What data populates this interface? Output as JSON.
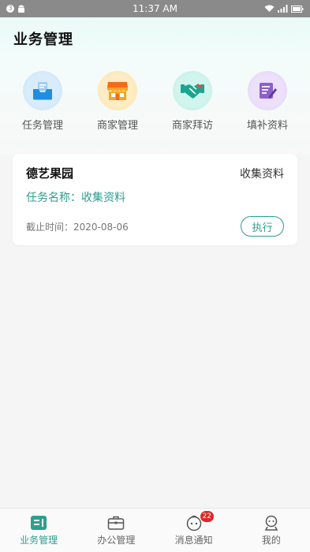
{
  "status_bar": {
    "time": "11:37 AM",
    "notification_count": "3"
  },
  "header": {
    "title": "业务管理"
  },
  "quick_nav": [
    {
      "label": "任务管理",
      "icon": "inbox-icon",
      "color": "#1e8fe0"
    },
    {
      "label": "商家管理",
      "icon": "store-icon",
      "color": "#f29a1a"
    },
    {
      "label": "商家拜访",
      "icon": "handshake-icon",
      "color": "#1aa58f"
    },
    {
      "label": "填补资料",
      "icon": "edit-document-icon",
      "color": "#8e5fd0"
    }
  ],
  "task_card": {
    "shop_name": "德艺果园",
    "type": "收集资料",
    "task_name": "任务名称：收集资料",
    "deadline": "截止时间：2020-08-06",
    "action_label": "执行"
  },
  "bottom_nav": [
    {
      "label": "业务管理",
      "icon": "business-icon",
      "active": true
    },
    {
      "label": "办公管理",
      "icon": "briefcase-icon",
      "active": false
    },
    {
      "label": "消息通知",
      "icon": "message-icon",
      "active": false,
      "badge": "22"
    },
    {
      "label": "我的",
      "icon": "profile-icon",
      "active": false
    }
  ],
  "colors": {
    "accent": "#2e9e8f",
    "badge": "#e02828"
  }
}
